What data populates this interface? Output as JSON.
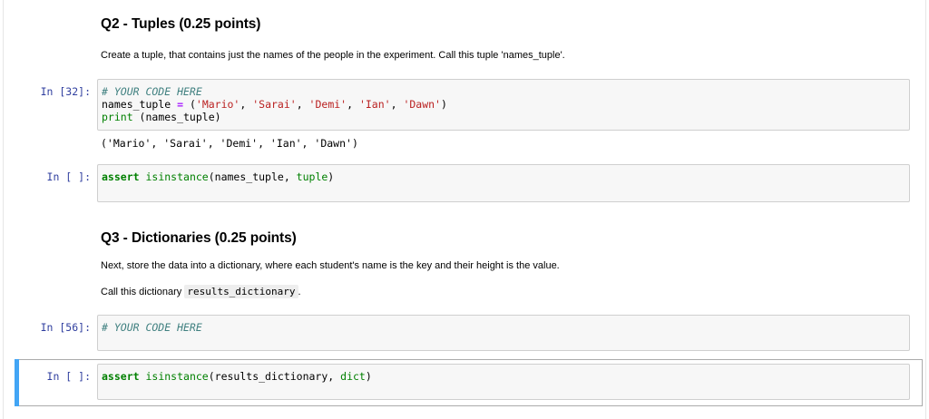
{
  "q2": {
    "heading": "Q2 - Tuples (0.25 points)",
    "text": "Create a tuple, that contains just the names of the people in the experiment. Call this tuple 'names_tuple'."
  },
  "cell32": {
    "prompt": "In [32]:",
    "comment": "# YOUR CODE HERE",
    "line2_var": "names_tuple ",
    "line2_eq": "=",
    "line2_open": " (",
    "names": [
      "'Mario'",
      "'Sarai'",
      "'Demi'",
      "'Ian'",
      "'Dawn'"
    ],
    "sep": ", ",
    "line2_close": ")",
    "line3_fn": "print",
    "line3_rest": " (names_tuple)",
    "output": "('Mario', 'Sarai', 'Demi', 'Ian', 'Dawn')"
  },
  "cell_assert1": {
    "prompt": "In [ ]:",
    "kw": "assert",
    "fn": "isinstance",
    "args": "(names_tuple, ",
    "type": "tuple",
    "close": ")"
  },
  "q3": {
    "heading": "Q3 - Dictionaries (0.25 points)",
    "text1": "Next, store the data into a dictionary, where each student's name is the key and their height is the value.",
    "text2_pre": "Call this dictionary ",
    "text2_code": "results_dictionary",
    "text2_post": "."
  },
  "cell56": {
    "prompt": "In [56]:",
    "comment": "# YOUR CODE HERE"
  },
  "cell_assert2": {
    "prompt": "In [ ]:",
    "kw": "assert",
    "fn": "isinstance",
    "args": "(results_dictionary, ",
    "type": "dict",
    "close": ")"
  },
  "colors": {
    "prompt": "#303f9f",
    "selected_bar": "#42a5f5",
    "keyword": "#008000",
    "string": "#ba2121",
    "comment": "#408080"
  }
}
